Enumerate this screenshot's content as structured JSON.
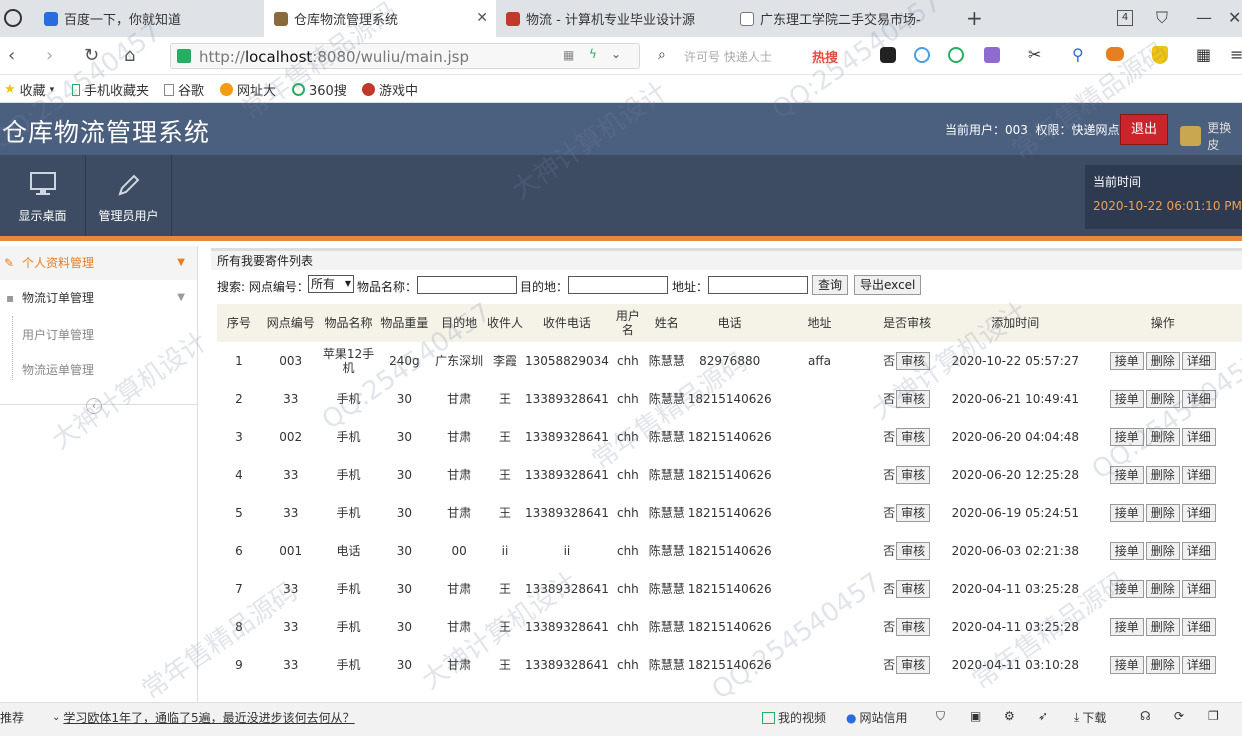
{
  "browser": {
    "tabs": [
      {
        "label": "百度一下，你就知道",
        "color": "#2b6be0"
      },
      {
        "label": "仓库物流管理系统",
        "color": "#8a6a3a"
      },
      {
        "label": "物流 - 计算机专业毕业设计源",
        "color": "#c0392b"
      },
      {
        "label": "广东理工学院二手交易市场-",
        "color": "#777777"
      }
    ],
    "tab_count": "4",
    "url_prefix": "http://",
    "url_host": "localhost",
    "url_path": ":8080/wuliu/main.jsp",
    "search_placeholder": "许可号 快递人士",
    "hot_label": "热搜",
    "bookmarks": [
      "收藏",
      "手机收藏夹",
      "谷歌",
      "网址大",
      "360搜",
      "游戏中"
    ]
  },
  "app": {
    "title": "仓库物流管理系统",
    "current_user_label": "当前用户：003",
    "role_label": "权限：快递网点",
    "logout": "退出",
    "switch_skin": "更换皮",
    "menu": [
      {
        "label": "显示桌面",
        "icon": "monitor-icon"
      },
      {
        "label": "管理员用户",
        "icon": "pencil-icon"
      }
    ],
    "time_label": "当前时间",
    "time_value": "2020-10-22 06:01:10 PM"
  },
  "sidebar": {
    "items": [
      {
        "label": "个人资料管理"
      },
      {
        "label": "物流订单管理"
      }
    ],
    "subs": [
      "用户订单管理",
      "物流运单管理"
    ]
  },
  "list": {
    "title": "所有我要寄件列表",
    "search_label": "搜索: 网点编号：",
    "select_value": "所有",
    "name_label": "物品名称：",
    "dest_label": "目的地：",
    "addr_label": "地址：",
    "query_btn": "查询",
    "export_btn": "导出excel",
    "headers": [
      "序号",
      "网点编号",
      "物品名称",
      "物品重量",
      "目的地",
      "收件人",
      "收件电话",
      "用户名",
      "姓名",
      "电话",
      "地址",
      "是否审核",
      "添加时间",
      "操作"
    ],
    "audit_btn": "审核",
    "action_btns": [
      "接单",
      "删除",
      "详细"
    ],
    "rows": [
      [
        "1",
        "003",
        "苹果12手机",
        "240g",
        "广东深圳",
        "李霞",
        "13058829034",
        "chh",
        "陈慧慧",
        "82976880",
        "affa",
        "否",
        "2020-10-22 05:57:27"
      ],
      [
        "2",
        "33",
        "手机",
        "30",
        "甘肃",
        "王",
        "13389328641",
        "chh",
        "陈慧慧",
        "18215140626",
        "",
        "否",
        "2020-06-21 10:49:41"
      ],
      [
        "3",
        "002",
        "手机",
        "30",
        "甘肃",
        "王",
        "13389328641",
        "chh",
        "陈慧慧",
        "18215140626",
        "",
        "否",
        "2020-06-20 04:04:48"
      ],
      [
        "4",
        "33",
        "手机",
        "30",
        "甘肃",
        "王",
        "13389328641",
        "chh",
        "陈慧慧",
        "18215140626",
        "",
        "否",
        "2020-06-20 12:25:28"
      ],
      [
        "5",
        "33",
        "手机",
        "30",
        "甘肃",
        "王",
        "13389328641",
        "chh",
        "陈慧慧",
        "18215140626",
        "",
        "否",
        "2020-06-19 05:24:51"
      ],
      [
        "6",
        "001",
        "电话",
        "30",
        "00",
        "ii",
        "ii",
        "chh",
        "陈慧慧",
        "18215140626",
        "",
        "否",
        "2020-06-03 02:21:38"
      ],
      [
        "7",
        "33",
        "手机",
        "30",
        "甘肃",
        "王",
        "13389328641",
        "chh",
        "陈慧慧",
        "18215140626",
        "",
        "否",
        "2020-04-11 03:25:28"
      ],
      [
        "8",
        "33",
        "手机",
        "30",
        "甘肃",
        "王",
        "13389328641",
        "chh",
        "陈慧慧",
        "18215140626",
        "",
        "否",
        "2020-04-11 03:25:28"
      ],
      [
        "9",
        "33",
        "手机",
        "30",
        "甘肃",
        "王",
        "13389328641",
        "chh",
        "陈慧慧",
        "18215140626",
        "",
        "否",
        "2020-04-11 03:10:28"
      ]
    ]
  },
  "statusbar": {
    "left_label": "推荐",
    "news": "学习欧体1年了，通临了5遍，最近没进步该何去何从？",
    "video": "我的视频",
    "credit": "网站信用",
    "download": "下载"
  },
  "watermarks": [
    "QQ:254540457",
    "常年售精品源码",
    "大神计算机设计"
  ]
}
